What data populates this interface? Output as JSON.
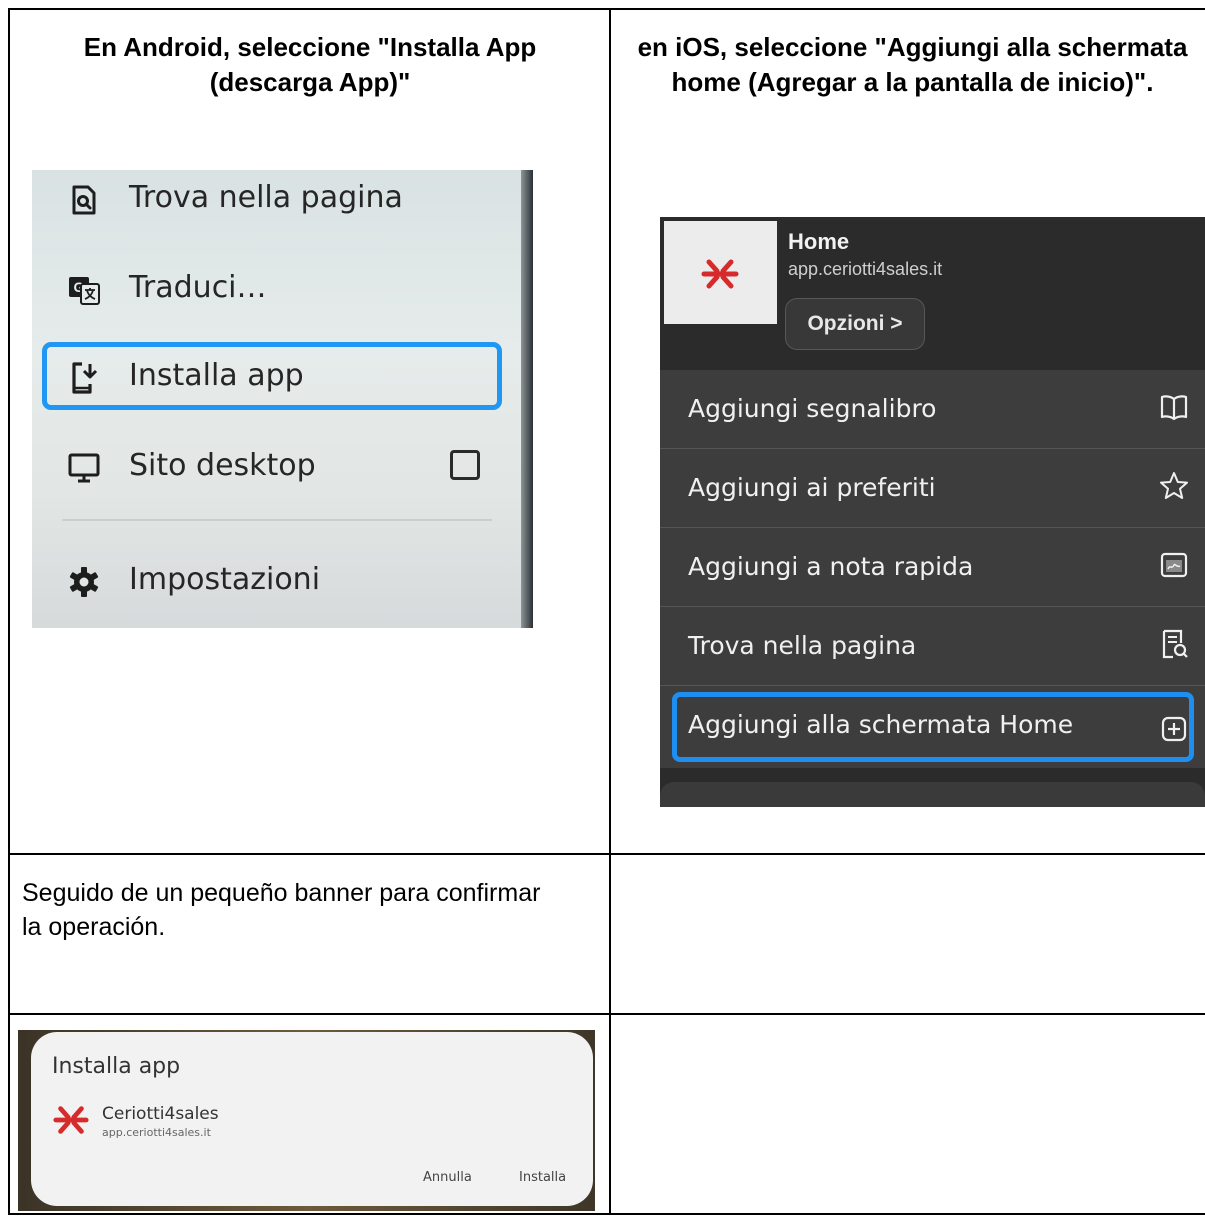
{
  "table": {
    "header_left": "En Android, seleccione \"Installa App (descarga App)\"",
    "header_right": "en iOS, seleccione \"Aggiungi alla schermata home (Agregar a la pantalla de inicio)\".",
    "note_text": "Seguido de un pequeño banner para confirmar la operación."
  },
  "android_menu": {
    "items": [
      {
        "label": "Trova nella pagina",
        "icon": "find-in-page-icon"
      },
      {
        "label": "Traduci…",
        "icon": "translate-icon"
      },
      {
        "label": "Installa app",
        "icon": "install-app-icon"
      },
      {
        "label": "Sito desktop",
        "icon": "desktop-icon"
      },
      {
        "label": "Impostazioni",
        "icon": "gear-icon"
      }
    ],
    "highlighted_item": "Installa app",
    "highlight_color": "#2196f3"
  },
  "ios_menu": {
    "site_title": "Home",
    "site_url": "app.ceriotti4sales.it",
    "options_label": "Opzioni >",
    "items": [
      {
        "label": "Aggiungi segnalibro",
        "icon": "book-icon"
      },
      {
        "label": "Aggiungi ai preferiti",
        "icon": "star-icon"
      },
      {
        "label": "Aggiungi a nota rapida",
        "icon": "quick-note-icon"
      },
      {
        "label": "Trova nella pagina",
        "icon": "find-document-icon"
      },
      {
        "label": "Aggiungi alla schermata Home",
        "icon": "plus-square-icon"
      }
    ],
    "highlighted_item": "Aggiungi alla schermata Home",
    "highlight_color": "#1e8ff0"
  },
  "install_dialog": {
    "title": "Installa app",
    "app_name": "Ceriotti4sales",
    "app_url": "app.ceriotti4sales.it",
    "cancel_label": "Annulla",
    "install_label": "Installa"
  },
  "colors": {
    "brand_red": "#d62b2b"
  }
}
